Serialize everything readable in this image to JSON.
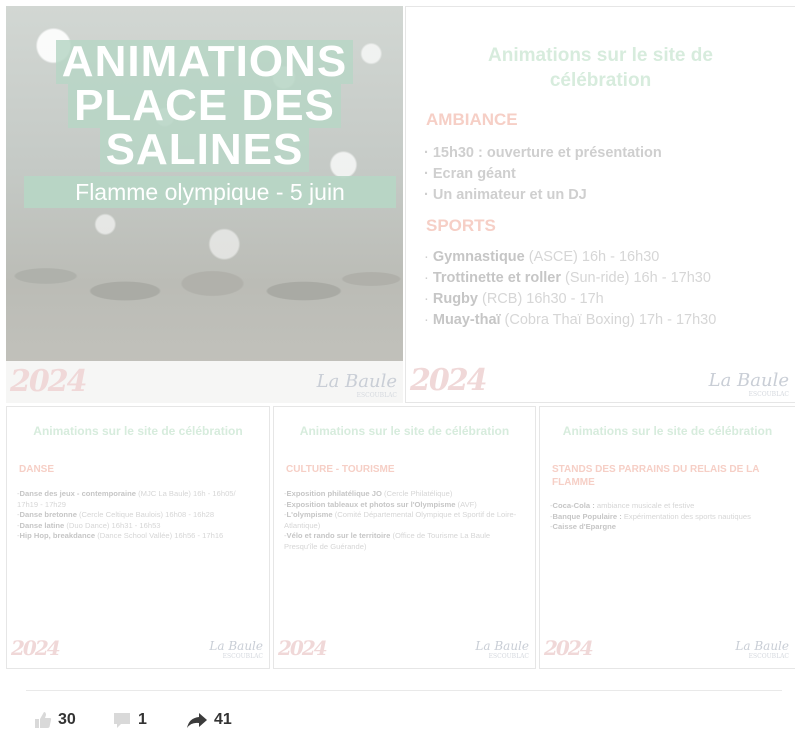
{
  "hero": {
    "title_lines": [
      "ANIMATIONS",
      "PLACE DES",
      "SALINES"
    ],
    "subtitle": "Flamme olympique - 5 juin",
    "logo_2024": "2024",
    "logo_city": "La Baule",
    "logo_city_small": "ESCOUBLAC"
  },
  "main_card": {
    "title": "Animations sur le site de célébration",
    "ambiance_heading": "AMBIANCE",
    "ambiance_items": [
      "15h30 : ouverture et présentation",
      "Ecran géant",
      "Un animateur et un DJ"
    ],
    "sports_heading": "SPORTS",
    "sports_items": [
      {
        "name": "Gymnastique",
        "detail": " (ASCE) 16h - 16h30"
      },
      {
        "name": "Trottinette et roller",
        "detail": " (Sun-ride) 16h - 17h30"
      },
      {
        "name": "Rugby",
        "detail": " (RCB) 16h30 - 17h"
      },
      {
        "name": "Muay-thaï",
        "detail": " (Cobra Thaï Boxing) 17h - 17h30"
      }
    ]
  },
  "danse_card": {
    "title": "Animations sur le site de célébration",
    "heading": "DANSE",
    "items": [
      {
        "name": "Danse des jeux - contemporaine",
        "detail": " (MJC La Baule) 16h - 16h05/ 17h19 - 17h29"
      },
      {
        "name": "Danse bretonne",
        "detail": " (Cercle Celtique Baulois) 16h08 - 16h28"
      },
      {
        "name": "Danse latine",
        "detail": " (Duo Dance) 16h31 - 16h53"
      },
      {
        "name": "Hip Hop, breakdance",
        "detail": " (Dance School Vallée) 16h56 - 17h16"
      }
    ]
  },
  "culture_card": {
    "title": "Animations sur le site de célébration",
    "heading": "CULTURE - TOURISME",
    "items": [
      {
        "name": "Exposition philatélique JO",
        "detail": " (Cercle Philatélique)"
      },
      {
        "name": "Exposition tableaux et photos sur l'Olympisme",
        "detail": " (AVF)"
      },
      {
        "name": "L'olympisme",
        "detail": " (Comité Départemental Olympique et Sportif de Loire-Atlantique)"
      },
      {
        "name": "Vélo et rando sur le territoire",
        "detail": " (Office de Tourisme La Baule Presqu'île de Guérande)"
      }
    ]
  },
  "stands_card": {
    "title": "Animations sur le site de célébration",
    "heading": "STANDS DES PARRAINS DU RELAIS DE LA FLAMME",
    "items": [
      {
        "name": "Coca-Cola :",
        "detail": " ambiance musicale et festive"
      },
      {
        "name": "Banque Populaire :",
        "detail": " Expérimentation des sports nautiques"
      },
      {
        "name": "Caisse d'Epargne",
        "detail": ""
      }
    ]
  },
  "stats": {
    "likes": "30",
    "comments": "1",
    "shares": "41"
  },
  "colors": {
    "title_green": "#d7ecdd",
    "heading_salmon": "#f6cfc6",
    "hero_band": "#b7d6c5"
  }
}
